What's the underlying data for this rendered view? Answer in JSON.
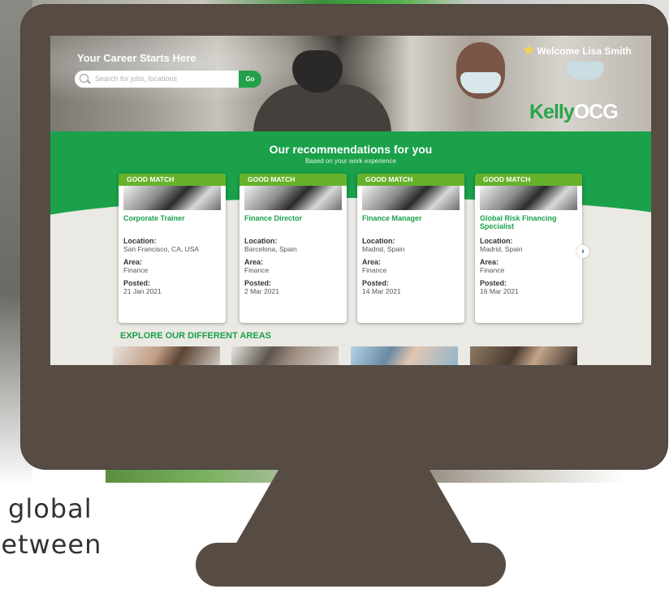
{
  "header": {
    "title": "Your Career Starts Here",
    "search_placeholder": "Search for jobs, locations",
    "go_label": "Go",
    "welcome": "Welcome Lisa Smith",
    "logo_part1": "Kelly",
    "logo_part2": "OCG"
  },
  "recommendations": {
    "title": "Our recommendations for you",
    "subtitle": "Based on your work experience",
    "labels": {
      "location": "Location:",
      "area": "Area:",
      "posted": "Posted:"
    },
    "cards": [
      {
        "badge": "GOOD MATCH",
        "title": "Corporate Trainer",
        "location": "San Francisco, CA, USA",
        "area": "Finance",
        "posted": "21 Jan 2021"
      },
      {
        "badge": "GOOD MATCH",
        "title": "Finance Director",
        "location": "Barcelona, Spain",
        "area": "Finance",
        "posted": "2 Mar 2021"
      },
      {
        "badge": "GOOD MATCH",
        "title": "Finance Manager",
        "location": "Madrid, Spain",
        "area": "Finance",
        "posted": "14 Mar 2021"
      },
      {
        "badge": "GOOD MATCH",
        "title": "Global Risk Financing Specialist",
        "location": "Madrid, Spain",
        "area": "Finance",
        "posted": "16 Mar 2021"
      }
    ],
    "next_glyph": "›"
  },
  "explore": {
    "title": "EXPLORE OUR DIFFERENT AREAS"
  },
  "slide": {
    "line1": "global",
    "line2": "between"
  },
  "colors": {
    "brand_green": "#1aa14a",
    "badge_green": "#66b22a",
    "monitor": "#574c44"
  }
}
